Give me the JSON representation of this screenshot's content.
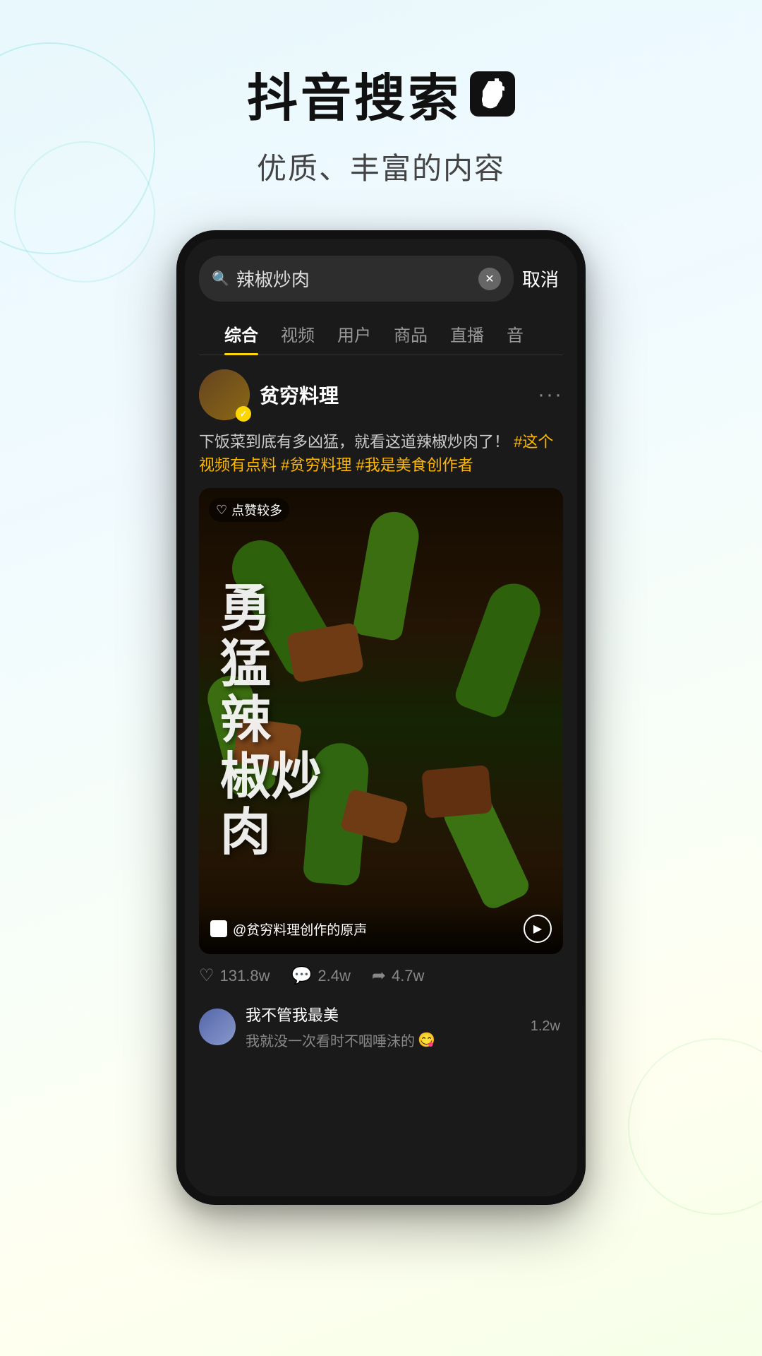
{
  "page": {
    "background": "gradient-light-blue-green"
  },
  "header": {
    "main_title": "抖音搜索",
    "sub_title": "优质、丰富的内容",
    "logo_label": "TikTok Logo"
  },
  "search": {
    "query": "辣椒炒肉",
    "placeholder": "辣椒炒肉",
    "cancel_label": "取消",
    "clear_icon": "×"
  },
  "tabs": [
    {
      "label": "综合",
      "active": true
    },
    {
      "label": "视频",
      "active": false
    },
    {
      "label": "用户",
      "active": false
    },
    {
      "label": "商品",
      "active": false
    },
    {
      "label": "直播",
      "active": false
    },
    {
      "label": "音",
      "active": false
    }
  ],
  "result_card": {
    "account": {
      "name": "贫穷料理",
      "verified": true,
      "more_icon": "···"
    },
    "description": "下饭菜到底有多凶猛，就看这道辣椒炒肉了！",
    "tags": "#这个视频有点料 #贫穷料理 #我是美食创作者",
    "video_badge": "点赞较多",
    "video_title_lines": [
      "勇",
      "猛",
      "辣",
      "椒炒",
      "肉"
    ],
    "video_title_full": "勇猛辣椒炒肉",
    "audio_label": "@贫穷料理创作的原声",
    "stats": {
      "likes": "131.8w",
      "comments": "2.4w",
      "shares": "4.7w"
    }
  },
  "next_result": {
    "user_name": "我不管我最美",
    "description": "我就没一次看时不咽唾沫的",
    "emoji": "😋",
    "count": "1.2w"
  },
  "icons": {
    "search": "🔍",
    "heart": "♡",
    "comment": "💬",
    "share": "➦",
    "play": "▶",
    "tiktok_note": "♪",
    "verified": "✓"
  }
}
